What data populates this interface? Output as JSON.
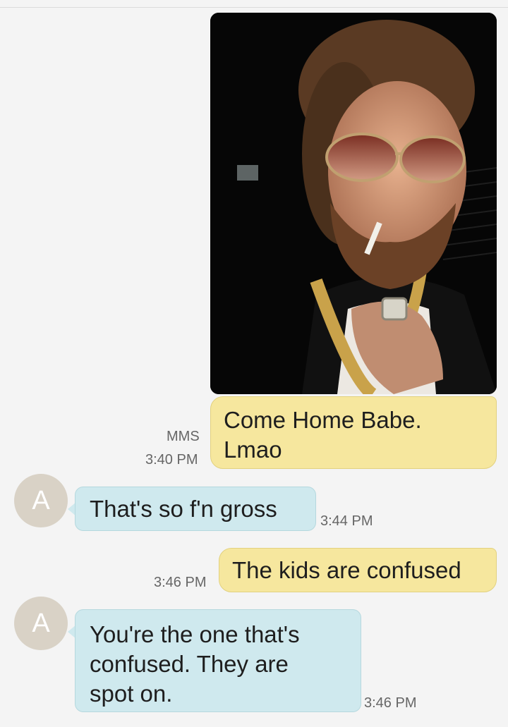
{
  "messages": [
    {
      "direction": "outgoing",
      "type": "MMS",
      "text": "Come Home Babe.\nLmao",
      "time": "3:40 PM"
    },
    {
      "direction": "incoming",
      "avatar_letter": "A",
      "text": "That's so f'n gross",
      "time": "3:44 PM"
    },
    {
      "direction": "outgoing",
      "text": "The kids are confused",
      "time": "3:46 PM"
    },
    {
      "direction": "incoming",
      "avatar_letter": "A",
      "text": "You're the one that's\nconfused. They are\nspot on.",
      "time": "3:46 PM"
    }
  ]
}
